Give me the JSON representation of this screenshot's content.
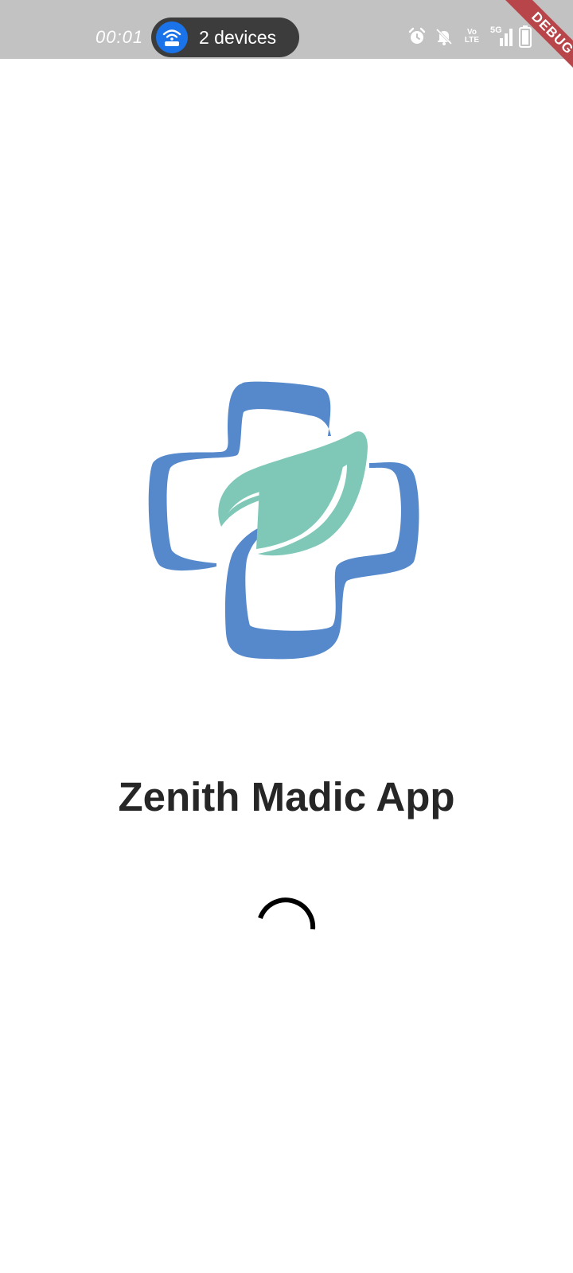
{
  "status_bar": {
    "time": "00:01",
    "hotspot": {
      "label": "2 devices",
      "icon": "hotspot-router-icon",
      "color": "#1a73e8"
    },
    "icons": [
      "alarm-icon",
      "muted-bell-icon",
      "volte-icon",
      "signal-5g-icon",
      "battery-icon"
    ],
    "volte_line1": "Vo",
    "volte_line2": "LTE",
    "network": "5G"
  },
  "debug_banner": {
    "label": "DEBUG",
    "color": "#b8454a"
  },
  "logo": {
    "icon": "medical-cross-leaf-logo",
    "cross_color": "#5589cc",
    "leaf_color": "#7fc8b8"
  },
  "title": "Zenith Madic App",
  "spinner": {
    "icon": "loading-spinner"
  }
}
